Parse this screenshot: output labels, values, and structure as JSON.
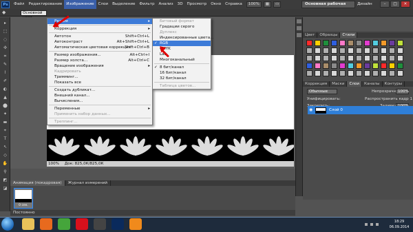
{
  "app": {
    "logo": "Ps",
    "zoom": "100%"
  },
  "menubar": {
    "items": [
      "Файл",
      "Редактирование",
      "Изображение",
      "Слои",
      "Выделение",
      "Фильтр",
      "Анализ",
      "3D",
      "Просмотр",
      "Окно",
      "Справка"
    ],
    "active": "Изображение"
  },
  "topright": {
    "workspace_button": "Основная рабочая среда",
    "design_label": "Дизайн",
    "window_buttons": [
      "–",
      "□",
      "✕"
    ]
  },
  "options_bar": {
    "preset_field": "Основной цвет"
  },
  "image_menu": {
    "items": [
      {
        "label": "Режим",
        "submenu": true,
        "highlight": true
      },
      {
        "sep": true
      },
      {
        "label": "Коррекция",
        "submenu": true
      },
      {
        "sep": true
      },
      {
        "label": "Автотон",
        "shortcut": "Shift+Ctrl+L"
      },
      {
        "label": "Автоконтраст",
        "shortcut": "Alt+Shift+Ctrl+L"
      },
      {
        "label": "Автоматическая цветовая коррекция",
        "shortcut": "Shift+Ctrl+B"
      },
      {
        "sep": true
      },
      {
        "label": "Размер изображения...",
        "shortcut": "Alt+Ctrl+I"
      },
      {
        "label": "Размер холста...",
        "shortcut": "Alt+Ctrl+C"
      },
      {
        "label": "Вращение изображения",
        "submenu": true
      },
      {
        "label": "Кадрировать",
        "disabled": true
      },
      {
        "label": "Тримминг..."
      },
      {
        "label": "Показать все"
      },
      {
        "sep": true
      },
      {
        "label": "Создать дубликат..."
      },
      {
        "label": "Внешний канал..."
      },
      {
        "label": "Вычисления..."
      },
      {
        "sep": true
      },
      {
        "label": "Переменные",
        "submenu": true
      },
      {
        "label": "Применить набор данных...",
        "disabled": true
      },
      {
        "sep": true
      },
      {
        "label": "Треппинг...",
        "disabled": true
      }
    ]
  },
  "mode_submenu": {
    "items": [
      {
        "label": "Битовый формат",
        "disabled": true
      },
      {
        "label": "Градации серого"
      },
      {
        "label": "Дуплекс",
        "disabled": true
      },
      {
        "label": "Индексированные цвета..."
      },
      {
        "label": "RGB",
        "checked": true,
        "highlight": true
      },
      {
        "label": "CMYK"
      },
      {
        "label": "Lab"
      },
      {
        "label": "Многоканальный"
      },
      {
        "sep": true
      },
      {
        "label": "8 бит/канал",
        "checked": true
      },
      {
        "label": "16 бит/канал"
      },
      {
        "label": "32 бит/канал"
      },
      {
        "sep": true
      },
      {
        "label": "Таблица цветов...",
        "disabled": true
      }
    ]
  },
  "document": {
    "zoom": "100%",
    "doc_info": "Док: 825,0К/825,0К"
  },
  "timeline": {
    "tabs": [
      "Анимация (покадровая)",
      "Журнал измерений"
    ],
    "frame_time": "0 сек.",
    "loop_label": "Постоянно"
  },
  "panels": {
    "swatches_tabs": [
      "Цвет",
      "Образцы",
      "Стили"
    ],
    "layers_tabs": [
      "Коррекция",
      "Маски",
      "Слои",
      "Каналы",
      "Контуры"
    ],
    "blend_mode": "Обычные",
    "opacity_label": "Непрозрачность:",
    "opacity_value": "100%",
    "unify_label": "Унифицировать:",
    "spread_label": "Распространить кадр 1",
    "lock_label": "Закрепить:",
    "fill_label": "Заливка:",
    "fill_value": "100%",
    "layer_name": "Слой 0",
    "swatch_colors": [
      "#ff2a2a",
      "#ffd000",
      "#1e8f3c",
      "#2f5fe0",
      "#ff7ac8",
      "#a98d6a",
      "#8a8a8a",
      "#e23ccf",
      "#53cde0",
      "#f39a2a",
      "#6b3c9e",
      "#bfe23a"
    ]
  },
  "taskbar": {
    "time": "18:29",
    "date": "06.09.2014",
    "apps": [
      "start",
      "explorer",
      "firefox",
      "utorrent",
      "opera",
      "monitor",
      "photoshop",
      "avast"
    ]
  },
  "colors": {
    "menu_highlight": "#3d7bd8",
    "annotation_arrow": "#e00000",
    "layer_selected": "#2f7fd8"
  }
}
